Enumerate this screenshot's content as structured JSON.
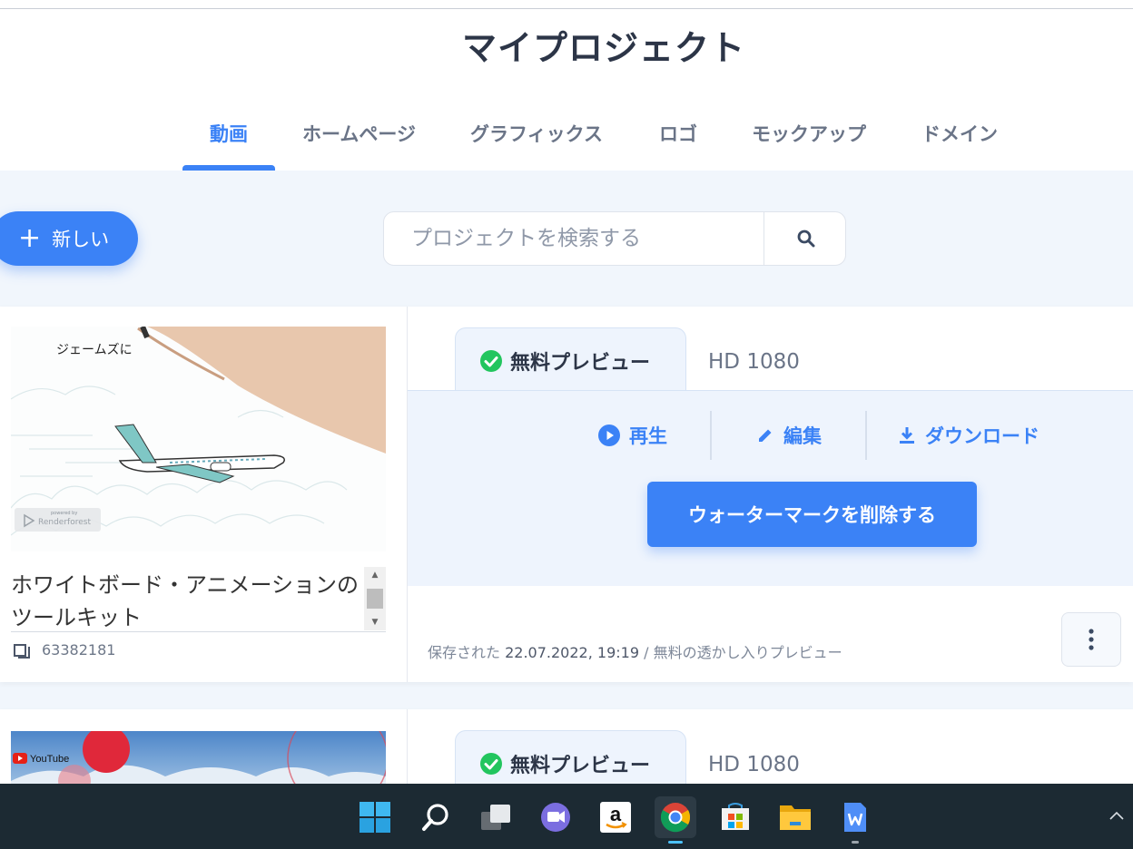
{
  "page": {
    "title": "マイプロジェクト"
  },
  "tabs": [
    "動画",
    "ホームページ",
    "グラフィックス",
    "ロゴ",
    "モックアップ",
    "ドメイン"
  ],
  "toolbar": {
    "new_label": "新しい",
    "search_placeholder": "プロジェクトを検索する"
  },
  "projects": [
    {
      "thumb_caption": "ジェームズに",
      "thumb_watermark": "Renderforest",
      "thumb_watermark_small": "powered by",
      "title": "ホワイトボード・アニメーションのツールキット",
      "id": "63382181",
      "status": "無料プレビュー",
      "quality": "HD 1080",
      "actions": {
        "play": "再生",
        "edit": "編集",
        "download": "ダウンロード"
      },
      "remove_watermark": "ウォーターマークを削除する",
      "saved_prefix": "保存された",
      "saved_date": "22.07.2022, 19:19",
      "saved_suffix": "/ 無料の透かし入りプレビュー"
    },
    {
      "thumb_logo": "YouTube",
      "status": "無料プレビュー",
      "quality": "HD 1080"
    }
  ],
  "colors": {
    "accent": "#3b82f6",
    "success": "#22c55e",
    "taskbar": "#1c2a33"
  },
  "taskbar": [
    "windows-start",
    "search",
    "task-view",
    "teams-chat",
    "amazon",
    "chrome",
    "microsoft-store",
    "file-explorer",
    "wps-writer"
  ]
}
